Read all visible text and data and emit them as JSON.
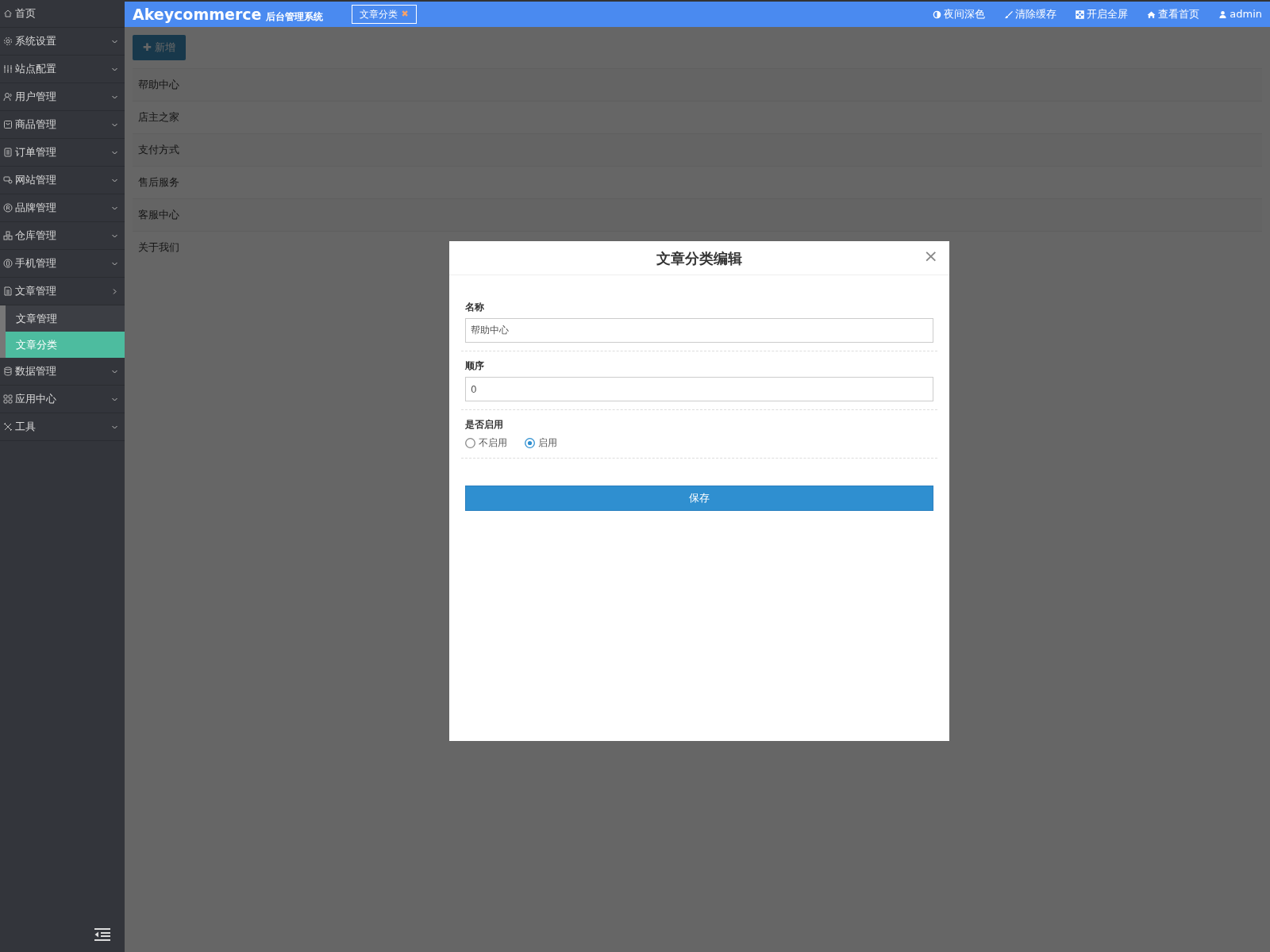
{
  "sidebar": {
    "home": "首页",
    "items": [
      {
        "label": "系统设置",
        "expanded": false
      },
      {
        "label": "站点配置",
        "expanded": false
      },
      {
        "label": "用户管理",
        "expanded": false
      },
      {
        "label": "商品管理",
        "expanded": false
      },
      {
        "label": "订单管理",
        "expanded": false
      },
      {
        "label": "网站管理",
        "expanded": false
      },
      {
        "label": "品牌管理",
        "expanded": false
      },
      {
        "label": "仓库管理",
        "expanded": false
      },
      {
        "label": "手机管理",
        "expanded": false
      },
      {
        "label": "文章管理",
        "expanded": true,
        "children": [
          {
            "label": "文章管理",
            "selected": false
          },
          {
            "label": "文章分类",
            "selected": true
          }
        ]
      },
      {
        "label": "数据管理",
        "expanded": false
      },
      {
        "label": "应用中心",
        "expanded": false
      },
      {
        "label": "工具",
        "expanded": false
      }
    ]
  },
  "header": {
    "brand": "Akeycommerce",
    "subtitle": "后台管理系统",
    "tab": {
      "label": "文章分类",
      "close": "✖"
    },
    "actions": [
      "夜间深色",
      "清除缓存",
      "开启全屏",
      "查看首页",
      "admin"
    ]
  },
  "content": {
    "add_button": "✚ 新增",
    "rows": [
      "帮助中心",
      "店主之家",
      "支付方式",
      "售后服务",
      "客服中心",
      "关于我们"
    ]
  },
  "modal": {
    "title": "文章分类编辑",
    "close": "×",
    "fields": [
      {
        "kind": "text",
        "label": "名称",
        "value": "帮助中心"
      },
      {
        "kind": "text",
        "label": "顺序",
        "value": "0"
      },
      {
        "kind": "radio",
        "label": "是否启用",
        "options": [
          {
            "label": "不启用",
            "selected": false
          },
          {
            "label": "启用",
            "selected": true
          }
        ]
      }
    ],
    "save": "保存"
  }
}
